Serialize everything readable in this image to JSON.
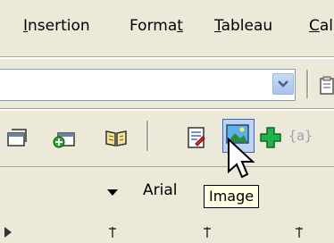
{
  "menubar": {
    "items": [
      {
        "prefix": "",
        "accel": "I",
        "rest": "nsertion"
      },
      {
        "prefix": "Forma",
        "accel": "t",
        "rest": ""
      },
      {
        "prefix": "",
        "accel": "T",
        "rest": "ableau"
      },
      {
        "prefix": "",
        "accel": "C",
        "rest": "al"
      }
    ]
  },
  "combo": {
    "value": ""
  },
  "toolbar": {
    "icons": [
      "window-icon",
      "window-add-icon",
      "book-icon",
      "document-icon",
      "image-icon",
      "plus-icon"
    ],
    "braces_label": "{a}"
  },
  "font_row": {
    "font_name": "Arial"
  },
  "tooltip": {
    "text": "Image"
  },
  "colors": {
    "background": "#ece9d8",
    "highlight": "#c1d2ee",
    "highlight_border": "#316ac5",
    "tooltip_bg": "#ffffe1"
  }
}
